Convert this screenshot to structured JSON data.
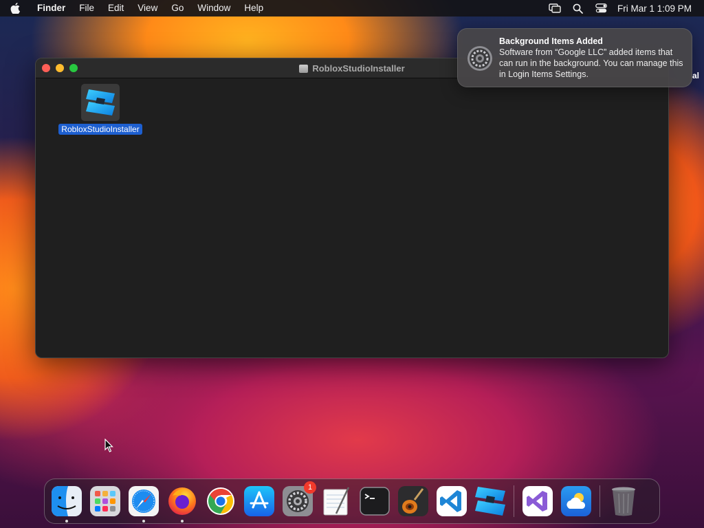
{
  "menubar": {
    "app_name": "Finder",
    "menus": [
      "File",
      "Edit",
      "View",
      "Go",
      "Window",
      "Help"
    ],
    "clock": "Fri Mar 1  1:09 PM",
    "status_icons": [
      "screen-mirroring-icon",
      "spotlight-search-icon",
      "control-center-icon"
    ]
  },
  "finder_window": {
    "title": "RobloxStudioInstaller",
    "items": [
      {
        "label": "RobloxStudioInstaller",
        "icon": "roblox-studio-icon",
        "selected": true
      }
    ]
  },
  "notification": {
    "title": "Background Items Added",
    "body": "Software from “Google LLC” added items that can run in the background. You can manage this in Login Items Settings.",
    "icon": "system-settings-icon"
  },
  "desktop_partial_label": "al",
  "dock": {
    "apps": [
      {
        "name": "Finder",
        "icon": "finder-icon",
        "running": true
      },
      {
        "name": "Launchpad",
        "icon": "launchpad-icon",
        "running": false
      },
      {
        "name": "Safari",
        "icon": "safari-icon",
        "running": true
      },
      {
        "name": "Firefox",
        "icon": "firefox-icon",
        "running": true
      },
      {
        "name": "Google Chrome",
        "icon": "chrome-icon",
        "running": false
      },
      {
        "name": "App Store",
        "icon": "app-store-icon",
        "running": false
      },
      {
        "name": "System Settings",
        "icon": "system-settings-icon",
        "running": false,
        "badge": "1"
      },
      {
        "name": "TextEdit",
        "icon": "textedit-icon",
        "running": false
      },
      {
        "name": "Terminal",
        "icon": "terminal-icon",
        "running": false
      },
      {
        "name": "GarageBand",
        "icon": "garageband-icon",
        "running": false
      },
      {
        "name": "Visual Studio Code",
        "icon": "vscode-icon",
        "running": false
      },
      {
        "name": "Roblox Studio",
        "icon": "roblox-studio-icon",
        "running": false
      },
      {
        "name": "Visual Studio",
        "icon": "visual-studio-icon",
        "running": false
      },
      {
        "name": "Weather",
        "icon": "weather-icon",
        "running": false
      },
      {
        "name": "Trash",
        "icon": "trash-icon",
        "running": false
      }
    ]
  },
  "colors": {
    "selection_blue": "#1d5fd0",
    "badge_red": "#f2392b",
    "traffic_red": "#fe5f57",
    "traffic_yellow": "#febc2e",
    "traffic_green": "#28c840"
  }
}
